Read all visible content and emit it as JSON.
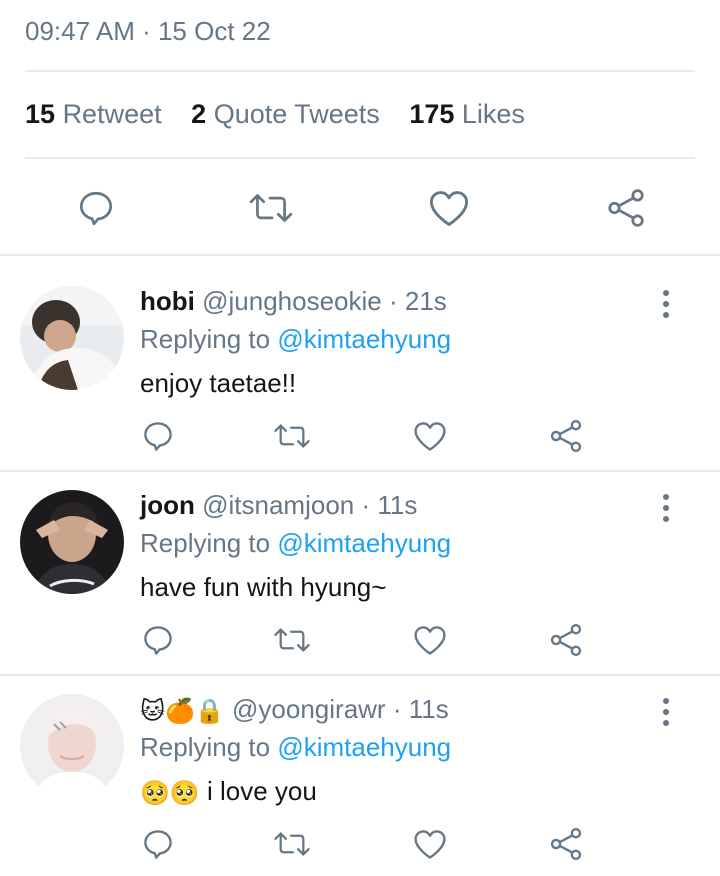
{
  "tweet": {
    "timestamp": "09:47 AM · 15 Oct 22",
    "stats": [
      {
        "count": "15",
        "label": "Retweet"
      },
      {
        "count": "2",
        "label": "Quote Tweets"
      },
      {
        "count": "175",
        "label": "Likes"
      }
    ],
    "actions": [
      "reply-icon",
      "retweet-icon",
      "like-icon",
      "share-icon"
    ]
  },
  "replies": [
    {
      "display_name": "hobi",
      "handle": "@junghoseokie",
      "time": "· 21s",
      "replying_prefix": "Replying to ",
      "replying_to": "@kimtaehyung",
      "text": "enjoy taetae!!"
    },
    {
      "display_name": "joon",
      "handle": "@itsnamjoon",
      "time": "· 11s",
      "replying_prefix": "Replying to ",
      "replying_to": "@kimtaehyung",
      "text": "have fun with hyung~"
    },
    {
      "display_name": "🐱🍊🔒",
      "handle": "@yoongirawr",
      "time": "· 11s",
      "replying_prefix": "Replying to ",
      "replying_to": "@kimtaehyung",
      "text_emoji": "🥺🥺",
      "text": "i love you"
    }
  ],
  "colors": {
    "accent": "#1da1f2",
    "secondary_text": "#657786",
    "divider": "#e6ecf0"
  }
}
